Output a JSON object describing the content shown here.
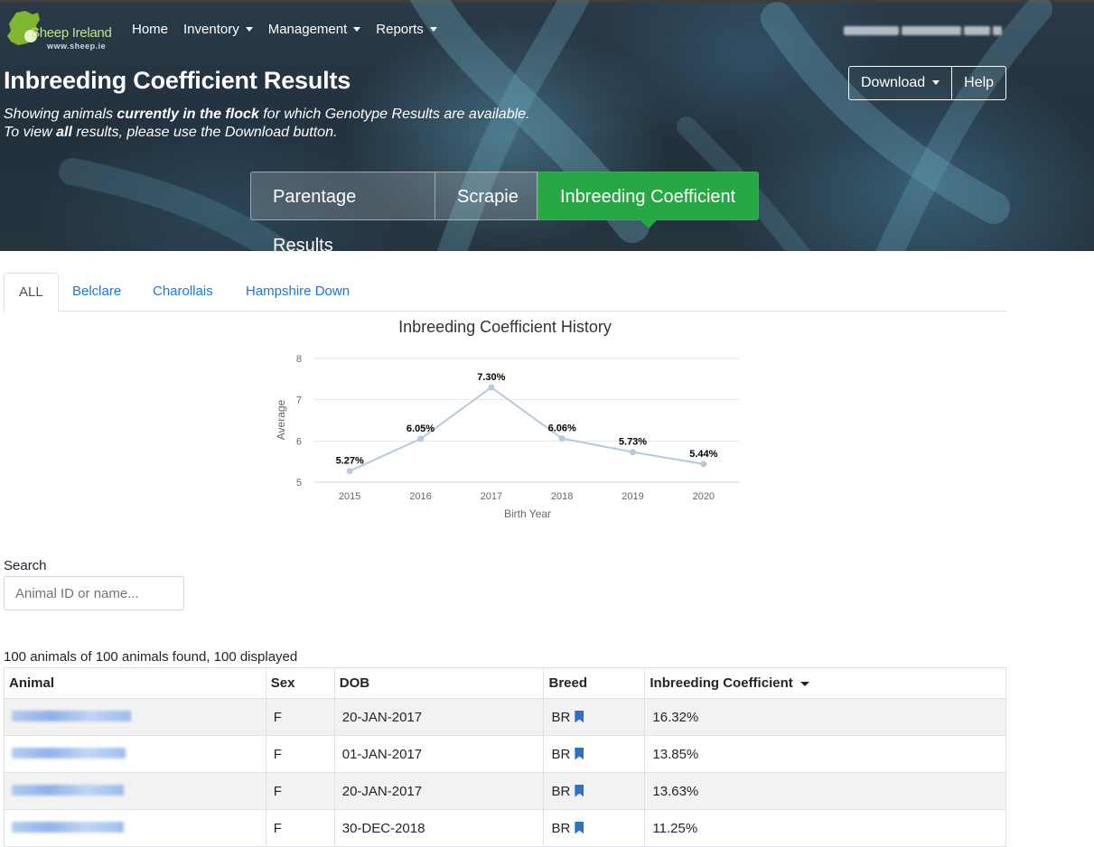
{
  "brand": {
    "name": "Sheep Ireland",
    "url": "www.sheep.ie",
    "accent": "#9ccc3a"
  },
  "nav": {
    "home": "Home",
    "inventory": "Inventory",
    "management": "Management",
    "reports": "Reports"
  },
  "header": {
    "title": "Inbreeding Coefficient Results",
    "subtitle_1_a": "Showing animals ",
    "subtitle_1_b": "currently in the flock",
    "subtitle_1_c": " for which Genotype Results are available.",
    "subtitle_2_a": "To view ",
    "subtitle_2_b": "all",
    "subtitle_2_c": " results, please use the Download button.",
    "download_label": "Download",
    "help_label": "Help"
  },
  "segments": {
    "parentage": "Parentage Results",
    "scrapie": "Scrapie",
    "inbreeding": "Inbreeding Coefficient",
    "active_color": "#28a745"
  },
  "tabs": {
    "all": "ALL",
    "belclare": "Belclare",
    "charollais": "Charollais",
    "hampshire": "Hampshire Down"
  },
  "chart_data": {
    "type": "line",
    "title": "Inbreeding Coefficient History",
    "xlabel": "Birth Year",
    "ylabel": "Average",
    "categories": [
      "2015",
      "2016",
      "2017",
      "2018",
      "2019",
      "2020"
    ],
    "values": [
      5.27,
      6.05,
      7.3,
      6.06,
      5.73,
      5.44
    ],
    "data_labels": [
      "5.27%",
      "6.05%",
      "7.30%",
      "6.06%",
      "5.73%",
      "5.44%"
    ],
    "ylim": [
      5,
      8
    ],
    "yticks": [
      "5",
      "6",
      "7",
      "8"
    ],
    "grid": true,
    "line_color": "#b7c9dc"
  },
  "search": {
    "label": "Search",
    "placeholder": "Animal ID or name..."
  },
  "results": {
    "count_text": "100 animals of 100 animals found, 100 displayed"
  },
  "table": {
    "headers": {
      "animal": "Animal",
      "sex": "Sex",
      "dob": "DOB",
      "breed": "Breed",
      "coefficient": "Inbreeding Coefficient"
    },
    "rows": [
      {
        "sex": "F",
        "dob": "20-JAN-2017",
        "breed": "BR",
        "coefficient": "16.32%"
      },
      {
        "sex": "F",
        "dob": "01-JAN-2017",
        "breed": "BR",
        "coefficient": "13.85%"
      },
      {
        "sex": "F",
        "dob": "20-JAN-2017",
        "breed": "BR",
        "coefficient": "13.63%"
      },
      {
        "sex": "F",
        "dob": "30-DEC-2018",
        "breed": "BR",
        "coefficient": "11.25%"
      }
    ]
  }
}
